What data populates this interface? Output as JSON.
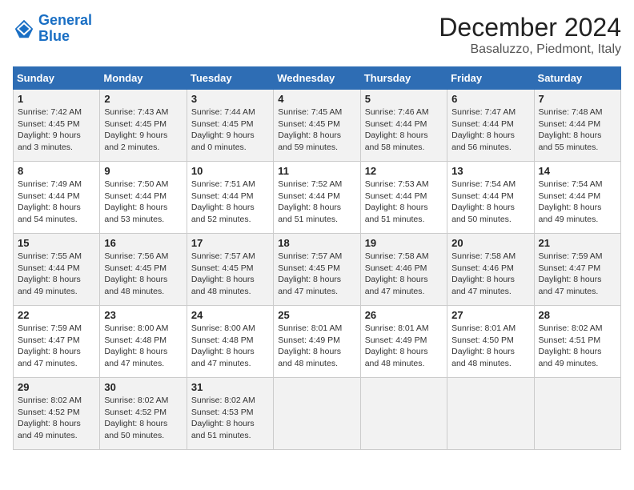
{
  "logo": {
    "line1": "General",
    "line2": "Blue"
  },
  "title": "December 2024",
  "location": "Basaluzzo, Piedmont, Italy",
  "days_of_week": [
    "Sunday",
    "Monday",
    "Tuesday",
    "Wednesday",
    "Thursday",
    "Friday",
    "Saturday"
  ],
  "weeks": [
    [
      {
        "day": "1",
        "info": "Sunrise: 7:42 AM\nSunset: 4:45 PM\nDaylight: 9 hours\nand 3 minutes."
      },
      {
        "day": "2",
        "info": "Sunrise: 7:43 AM\nSunset: 4:45 PM\nDaylight: 9 hours\nand 2 minutes."
      },
      {
        "day": "3",
        "info": "Sunrise: 7:44 AM\nSunset: 4:45 PM\nDaylight: 9 hours\nand 0 minutes."
      },
      {
        "day": "4",
        "info": "Sunrise: 7:45 AM\nSunset: 4:45 PM\nDaylight: 8 hours\nand 59 minutes."
      },
      {
        "day": "5",
        "info": "Sunrise: 7:46 AM\nSunset: 4:44 PM\nDaylight: 8 hours\nand 58 minutes."
      },
      {
        "day": "6",
        "info": "Sunrise: 7:47 AM\nSunset: 4:44 PM\nDaylight: 8 hours\nand 56 minutes."
      },
      {
        "day": "7",
        "info": "Sunrise: 7:48 AM\nSunset: 4:44 PM\nDaylight: 8 hours\nand 55 minutes."
      }
    ],
    [
      {
        "day": "8",
        "info": "Sunrise: 7:49 AM\nSunset: 4:44 PM\nDaylight: 8 hours\nand 54 minutes."
      },
      {
        "day": "9",
        "info": "Sunrise: 7:50 AM\nSunset: 4:44 PM\nDaylight: 8 hours\nand 53 minutes."
      },
      {
        "day": "10",
        "info": "Sunrise: 7:51 AM\nSunset: 4:44 PM\nDaylight: 8 hours\nand 52 minutes."
      },
      {
        "day": "11",
        "info": "Sunrise: 7:52 AM\nSunset: 4:44 PM\nDaylight: 8 hours\nand 51 minutes."
      },
      {
        "day": "12",
        "info": "Sunrise: 7:53 AM\nSunset: 4:44 PM\nDaylight: 8 hours\nand 51 minutes."
      },
      {
        "day": "13",
        "info": "Sunrise: 7:54 AM\nSunset: 4:44 PM\nDaylight: 8 hours\nand 50 minutes."
      },
      {
        "day": "14",
        "info": "Sunrise: 7:54 AM\nSunset: 4:44 PM\nDaylight: 8 hours\nand 49 minutes."
      }
    ],
    [
      {
        "day": "15",
        "info": "Sunrise: 7:55 AM\nSunset: 4:44 PM\nDaylight: 8 hours\nand 49 minutes."
      },
      {
        "day": "16",
        "info": "Sunrise: 7:56 AM\nSunset: 4:45 PM\nDaylight: 8 hours\nand 48 minutes."
      },
      {
        "day": "17",
        "info": "Sunrise: 7:57 AM\nSunset: 4:45 PM\nDaylight: 8 hours\nand 48 minutes."
      },
      {
        "day": "18",
        "info": "Sunrise: 7:57 AM\nSunset: 4:45 PM\nDaylight: 8 hours\nand 47 minutes."
      },
      {
        "day": "19",
        "info": "Sunrise: 7:58 AM\nSunset: 4:46 PM\nDaylight: 8 hours\nand 47 minutes."
      },
      {
        "day": "20",
        "info": "Sunrise: 7:58 AM\nSunset: 4:46 PM\nDaylight: 8 hours\nand 47 minutes."
      },
      {
        "day": "21",
        "info": "Sunrise: 7:59 AM\nSunset: 4:47 PM\nDaylight: 8 hours\nand 47 minutes."
      }
    ],
    [
      {
        "day": "22",
        "info": "Sunrise: 7:59 AM\nSunset: 4:47 PM\nDaylight: 8 hours\nand 47 minutes."
      },
      {
        "day": "23",
        "info": "Sunrise: 8:00 AM\nSunset: 4:48 PM\nDaylight: 8 hours\nand 47 minutes."
      },
      {
        "day": "24",
        "info": "Sunrise: 8:00 AM\nSunset: 4:48 PM\nDaylight: 8 hours\nand 47 minutes."
      },
      {
        "day": "25",
        "info": "Sunrise: 8:01 AM\nSunset: 4:49 PM\nDaylight: 8 hours\nand 48 minutes."
      },
      {
        "day": "26",
        "info": "Sunrise: 8:01 AM\nSunset: 4:49 PM\nDaylight: 8 hours\nand 48 minutes."
      },
      {
        "day": "27",
        "info": "Sunrise: 8:01 AM\nSunset: 4:50 PM\nDaylight: 8 hours\nand 48 minutes."
      },
      {
        "day": "28",
        "info": "Sunrise: 8:02 AM\nSunset: 4:51 PM\nDaylight: 8 hours\nand 49 minutes."
      }
    ],
    [
      {
        "day": "29",
        "info": "Sunrise: 8:02 AM\nSunset: 4:52 PM\nDaylight: 8 hours\nand 49 minutes."
      },
      {
        "day": "30",
        "info": "Sunrise: 8:02 AM\nSunset: 4:52 PM\nDaylight: 8 hours\nand 50 minutes."
      },
      {
        "day": "31",
        "info": "Sunrise: 8:02 AM\nSunset: 4:53 PM\nDaylight: 8 hours\nand 51 minutes."
      },
      {
        "day": "",
        "info": ""
      },
      {
        "day": "",
        "info": ""
      },
      {
        "day": "",
        "info": ""
      },
      {
        "day": "",
        "info": ""
      }
    ]
  ]
}
